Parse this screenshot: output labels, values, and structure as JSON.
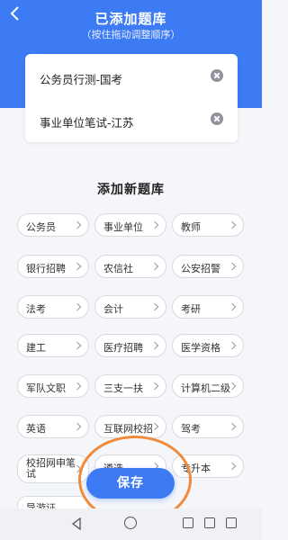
{
  "header": {
    "title": "已添加题库",
    "subtitle": "（按住拖动调整顺序）"
  },
  "added": [
    {
      "label": "公务员行测-国考"
    },
    {
      "label": "事业单位笔试-江苏"
    }
  ],
  "section_title": "添加新题库",
  "tags": [
    {
      "label": "公务员"
    },
    {
      "label": "事业单位"
    },
    {
      "label": "教师"
    },
    {
      "label": "银行招聘"
    },
    {
      "label": "农信社"
    },
    {
      "label": "公安招警"
    },
    {
      "label": "法考"
    },
    {
      "label": "会计"
    },
    {
      "label": "考研"
    },
    {
      "label": "建工"
    },
    {
      "label": "医疗招聘"
    },
    {
      "label": "医学资格"
    },
    {
      "label": "军队文职"
    },
    {
      "label": "三支一扶"
    },
    {
      "label": "计算机二级"
    },
    {
      "label": "英语"
    },
    {
      "label": "互联网校招"
    },
    {
      "label": "驾考"
    },
    {
      "label": "校招网申笔试"
    },
    {
      "label": "遴选"
    },
    {
      "label": "专升本"
    },
    {
      "label": "导游证"
    }
  ],
  "save_label": "保存",
  "colors": {
    "primary": "#3d7bf5",
    "highlight": "#f08a3c"
  }
}
